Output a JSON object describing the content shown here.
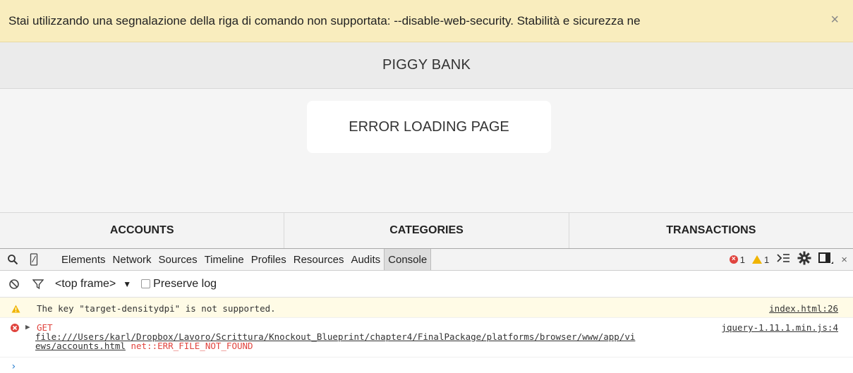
{
  "infobar": {
    "message": "Stai utilizzando una segnalazione della riga di comando non supportata: --disable-web-security. Stabilità e sicurezza ne",
    "close_glyph": "×"
  },
  "app": {
    "title": "PIGGY BANK",
    "error_message": "ERROR LOADING PAGE",
    "nav": [
      "ACCOUNTS",
      "CATEGORIES",
      "TRANSACTIONS"
    ]
  },
  "devtools": {
    "tabs": [
      "Elements",
      "Network",
      "Sources",
      "Timeline",
      "Profiles",
      "Resources",
      "Audits",
      "Console"
    ],
    "active_tab": "Console",
    "error_count": "1",
    "warning_count": "1",
    "frame_select": "<top frame>",
    "preserve_log_label": "Preserve log",
    "preserve_log_checked": false
  },
  "console": {
    "warning": {
      "text": "The key \"target-densitydpi\" is not supported.",
      "source": "index.html:26"
    },
    "error": {
      "method": "GET",
      "source": "jquery-1.11.1.min.js:4",
      "url_line1": "file:///Users/karl/Dropbox/Lavoro/Scrittura/Knockout_Blueprint/chapter4/FinalPackage/platforms/browser/www/app/vi",
      "url_line2": "ews/accounts.html",
      "error_code": "net::ERR_FILE_NOT_FOUND"
    }
  },
  "colors": {
    "infobar_bg": "#f9edbe",
    "error": "#e0443e",
    "warning": "#f0b400",
    "prompt": "#2a7fcf"
  }
}
